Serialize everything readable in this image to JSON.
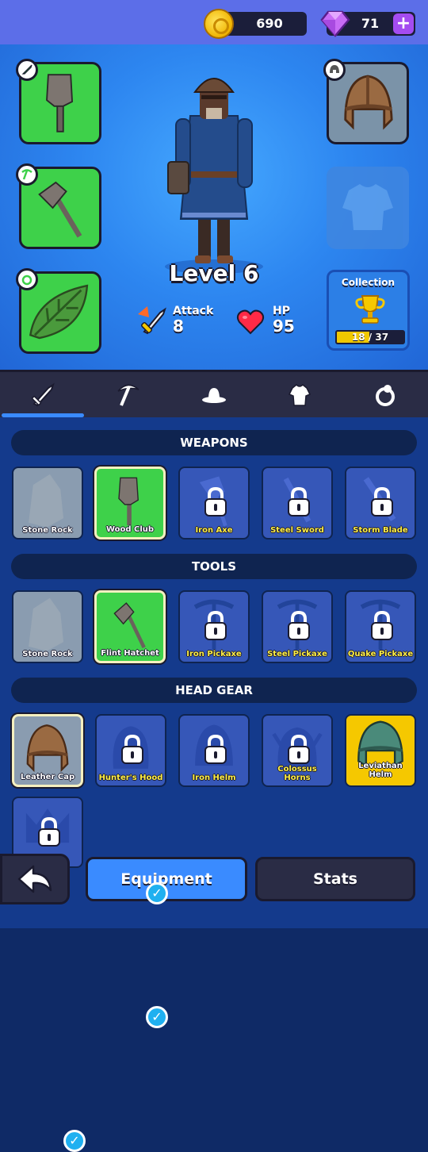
{
  "currency": {
    "coins": "690",
    "gems": "71",
    "plus_label": "+"
  },
  "hero": {
    "level_label": "Level 6",
    "stats": [
      {
        "label": "Attack",
        "value": "8",
        "icon": "sword-burst-icon"
      },
      {
        "label": "HP",
        "value": "95",
        "icon": "heart-icon"
      }
    ],
    "slots": [
      {
        "name": "weapon",
        "icon": "sword-icon",
        "item": "wood-club"
      },
      {
        "name": "tool",
        "icon": "pickaxe-icon",
        "item": "flint-hatchet"
      },
      {
        "name": "accessory",
        "icon": "ring-icon",
        "item": "leaf"
      },
      {
        "name": "head",
        "icon": "helmet-icon",
        "item": "leather-cap"
      },
      {
        "name": "body",
        "icon": "armor-icon",
        "item": null
      }
    ],
    "collection": {
      "label": "Collection",
      "progress_text": "18 / 37",
      "current": 18,
      "total": 37
    }
  },
  "tabs": [
    {
      "name": "weapons",
      "icon": "sword-icon",
      "active": true
    },
    {
      "name": "tools",
      "icon": "pickaxe-icon",
      "active": false
    },
    {
      "name": "hats",
      "icon": "hat-icon",
      "active": false
    },
    {
      "name": "armor",
      "icon": "armor-icon",
      "active": false
    },
    {
      "name": "accessories",
      "icon": "ring-icon",
      "active": false
    }
  ],
  "sections": {
    "weapons": {
      "title": "WEAPONS",
      "items": [
        {
          "name": "Stone Rock",
          "state": "owned"
        },
        {
          "name": "Wood Club",
          "state": "equipped"
        },
        {
          "name": "Iron Axe",
          "state": "locked"
        },
        {
          "name": "Steel Sword",
          "state": "locked"
        },
        {
          "name": "Storm Blade",
          "state": "locked"
        }
      ]
    },
    "tools": {
      "title": "TOOLS",
      "items": [
        {
          "name": "Stone Rock",
          "state": "owned"
        },
        {
          "name": "Flint Hatchet",
          "state": "equipped"
        },
        {
          "name": "Iron Pickaxe",
          "state": "locked"
        },
        {
          "name": "Steel Pickaxe",
          "state": "locked"
        },
        {
          "name": "Quake Pickaxe",
          "state": "locked"
        }
      ]
    },
    "head_gear": {
      "title": "HEAD GEAR",
      "items": [
        {
          "name": "Leather Cap",
          "state": "equipped"
        },
        {
          "name": "Hunter's Hood",
          "state": "locked"
        },
        {
          "name": "Iron Helm",
          "state": "locked"
        },
        {
          "name": "Colossus Horns",
          "state": "locked"
        },
        {
          "name": "Leviathan Helm",
          "state": "legendary"
        }
      ]
    }
  },
  "bottom_nav": {
    "equipment_label": "Equipment",
    "stats_label": "Stats"
  },
  "colors": {
    "accent": "#3a8bff",
    "owned_green": "#3ed14a",
    "legendary_gold": "#f5c800",
    "locked_blue": "#3657b8"
  }
}
